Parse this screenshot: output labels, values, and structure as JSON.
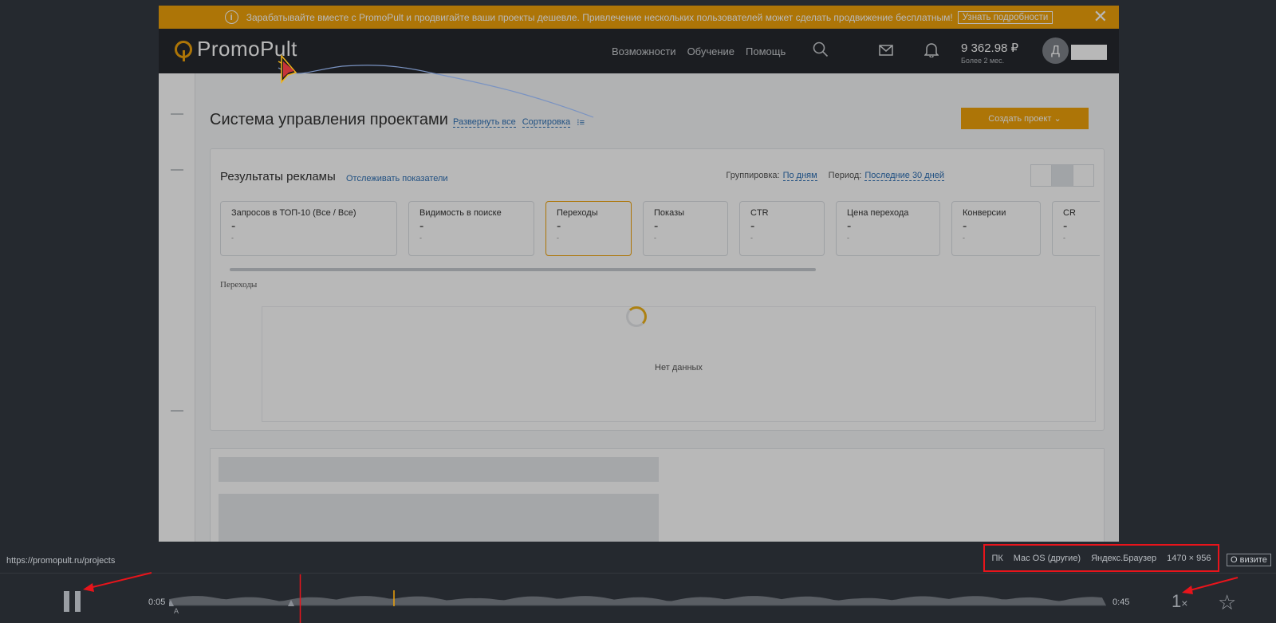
{
  "banner": {
    "text": "Зарабатывайте вместе с PromoPult и продвигайте ваши проекты дешевле. Привлечение нескольких пользователей может сделать продвижение бесплатным!",
    "more_label": "Узнать подробности",
    "close_glyph": "✕",
    "info_glyph": "i"
  },
  "header": {
    "logo_text": "PromoPult",
    "nav": [
      "Возможности",
      "Обучение",
      "Помощь"
    ],
    "balance": "9 362.98 ₽",
    "balance_note": "Более 2 мес.",
    "avatar_letter": "Д"
  },
  "page": {
    "title": "Система управления проектами",
    "expand_all": "Развернуть все",
    "sort": "Сортировка",
    "create_button": "Создать проект ⌄"
  },
  "results": {
    "title": "Результаты рекламы",
    "track_link": "Отслеживать показатели",
    "grouping_label": "Группировка:",
    "grouping_value": "По дням",
    "period_label": "Период:",
    "period_value": "Последние 30 дней",
    "metrics": [
      {
        "name": "Запросов в ТОП-10 (Все / Все)",
        "value": "-",
        "sub": "-"
      },
      {
        "name": "Видимость в поиске",
        "value": "-",
        "sub": "-"
      },
      {
        "name": "Переходы",
        "value": "-",
        "sub": "-"
      },
      {
        "name": "Показы",
        "value": "-",
        "sub": "-"
      },
      {
        "name": "CTR",
        "value": "-",
        "sub": "-"
      },
      {
        "name": "Цена перехода",
        "value": "-",
        "sub": "-"
      },
      {
        "name": "Конверсии",
        "value": "-",
        "sub": "-"
      },
      {
        "name": "CR",
        "value": "-",
        "sub": "-"
      }
    ],
    "chart_label": "Переходы",
    "no_data": "Нет данных"
  },
  "player": {
    "url": "https://promopult.ru/projects",
    "device": "ПК",
    "os": "Mac OS (другие)",
    "browser": "Яндекс.Браузер",
    "resolution": "1470 × 956",
    "visit_button": "О визите",
    "time_current": "0:05",
    "time_total": "0:45",
    "speed": "1",
    "speed_suffix": "×",
    "star_glyph": "☆",
    "marker_label": "A",
    "progress_fraction": 0.14
  },
  "colors": {
    "brand_orange": "#f0a30a",
    "highlight_red": "#e8141b",
    "player_bg": "#25292f"
  }
}
